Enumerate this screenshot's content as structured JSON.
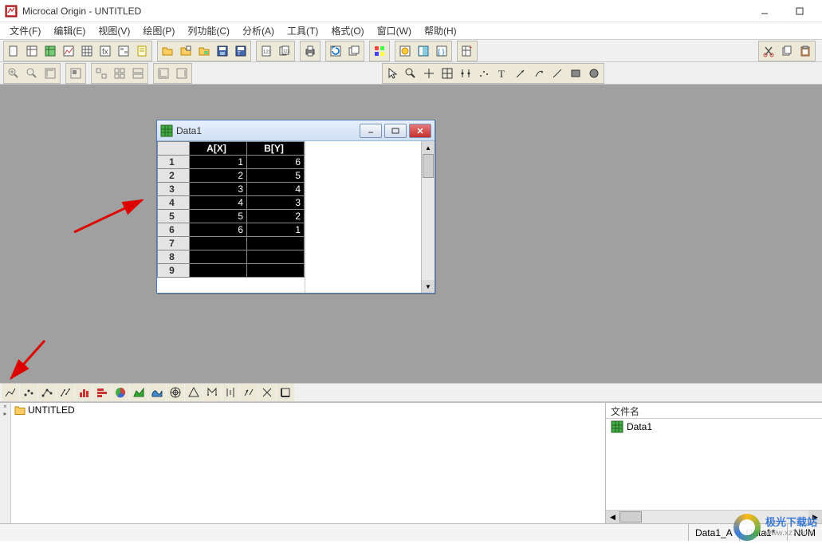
{
  "app": {
    "title": "Microcal Origin - UNTITLED"
  },
  "menus": {
    "file": "文件(F)",
    "edit": "编辑(E)",
    "view": "视图(V)",
    "plot": "绘图(P)",
    "column": "列功能(C)",
    "analysis": "分析(A)",
    "tools": "工具(T)",
    "format": "格式(O)",
    "window": "窗口(W)",
    "help": "帮助(H)"
  },
  "child_window": {
    "title": "Data1",
    "columns": {
      "row_header": "",
      "a": "A[X]",
      "b": "B[Y]"
    },
    "rows": [
      {
        "n": "1",
        "a": "1",
        "b": "6"
      },
      {
        "n": "2",
        "a": "2",
        "b": "5"
      },
      {
        "n": "3",
        "a": "3",
        "b": "4"
      },
      {
        "n": "4",
        "a": "4",
        "b": "3"
      },
      {
        "n": "5",
        "a": "5",
        "b": "2"
      },
      {
        "n": "6",
        "a": "6",
        "b": "1"
      },
      {
        "n": "7",
        "a": "",
        "b": ""
      },
      {
        "n": "8",
        "a": "",
        "b": ""
      },
      {
        "n": "9",
        "a": "",
        "b": ""
      }
    ]
  },
  "project_tree": {
    "root": "UNTITLED"
  },
  "file_panel": {
    "header": "文件名",
    "file1": "Data1"
  },
  "status": {
    "cell1": "Data1_A",
    "cell2": "Data1*",
    "cell3": "NUM"
  },
  "watermark": {
    "line1": "极光下载站",
    "line2": "www.xz7.com"
  },
  "chart_data": {
    "type": "table",
    "title": "Data1",
    "columns": [
      "A[X]",
      "B[Y]"
    ],
    "rows": [
      [
        1,
        6
      ],
      [
        2,
        5
      ],
      [
        3,
        4
      ],
      [
        4,
        3
      ],
      [
        5,
        2
      ],
      [
        6,
        1
      ]
    ]
  }
}
